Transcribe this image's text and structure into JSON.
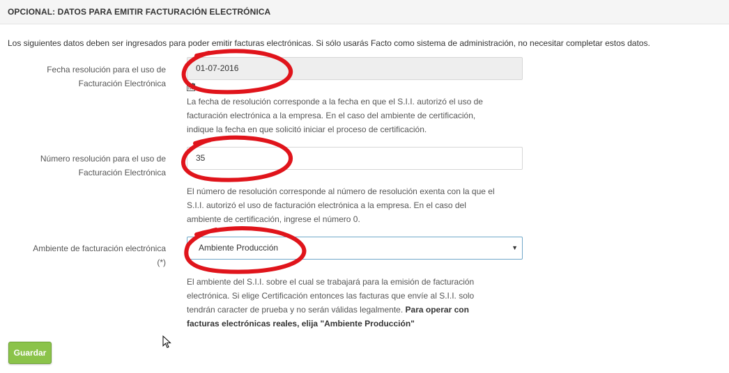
{
  "panel": {
    "title": "OPCIONAL: DATOS PARA EMITIR FACTURACIÓN ELECTRÓNICA"
  },
  "intro": "Los siguientes datos deben ser ingresados para poder emitir facturas electrónicas. Si sólo usarás Facto como sistema de administración, no necesitar completar estos datos.",
  "fields": {
    "fecha": {
      "label_line1": "Fecha resolución para el uso de",
      "label_line2": "Facturación Electrónica",
      "value": "01-07-2016",
      "help_line1": "La fecha de resolución corresponde a la fecha en que el S.I.I. autorizó el uso de",
      "help_line2": "facturación electrónica a la empresa. En el caso del ambiente de certificación,",
      "help_line3": "indique la fecha en que solicitó iniciar el proceso de certificación.",
      "icon": "calendar-icon"
    },
    "numero": {
      "label_line1": "Número resolución para el uso de",
      "label_line2": "Facturación Electrónica",
      "value": "35",
      "help_line1": "El número de resolución corresponde al número de resolución exenta con la que el",
      "help_line2": "S.I.I. autorizó el uso de facturación electrónica a la empresa. En el caso del",
      "help_line3": "ambiente de certificación, ingrese el número 0."
    },
    "ambiente": {
      "label_line1": "Ambiente de facturación electrónica",
      "label_line2": "(*)",
      "selected": "Ambiente Producción",
      "caret": "▼",
      "help_line1": "El ambiente del S.I.I. sobre el cual se trabajará para la emisión de facturación",
      "help_line2": "electrónica. Si elige Certificación entonces las facturas que envíe al S.I.I. solo",
      "help_line3_plain": "tendrán caracter de prueba y no serán válidas legalmente. ",
      "help_line3_bold": "Para operar con",
      "help_line4_bold": "facturas electrónicas reales, elija \"Ambiente Producción\""
    }
  },
  "actions": {
    "save_label": "Guardar"
  },
  "colors": {
    "save_button": "#8bc34a",
    "annotation": "#e0141b",
    "select_border": "#6fa7c9"
  }
}
